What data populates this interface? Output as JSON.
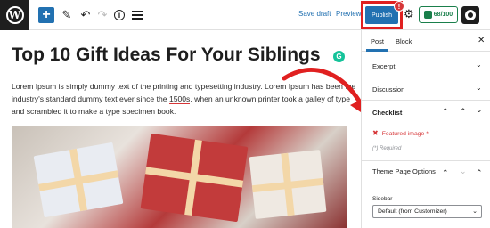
{
  "toolbar": {
    "logo": "W",
    "icons": [
      "wordpress-logo",
      "plus-icon",
      "pen-icon",
      "undo-icon",
      "redo-icon",
      "info-icon",
      "list-view-icon",
      "gear-icon",
      "settings-icon"
    ],
    "add": "+",
    "pen": "✎",
    "undo": "↶",
    "redo": "↷",
    "info": "i",
    "save_draft": "Save draft",
    "preview": "Preview",
    "publish": "Publish",
    "publish_alert": "!",
    "gear": "⚙",
    "score": "68/100",
    "accent": "#2271b1",
    "alert_color": "#d63638",
    "score_color": "#1a7f4b"
  },
  "editor": {
    "title": "Top 10 Gift Ideas For Your Siblings",
    "grammarly": "G",
    "paragraph_1": "Lorem Ipsum is simply dummy text of the printing and typesetting industry. Lorem Ipsum has been the industry's standard dummy text ever since the ",
    "paragraph_highlight": "1500s",
    "paragraph_2": ", when an unknown printer took a galley of type and scrambled it to make a type specimen book."
  },
  "sidebar": {
    "tabs": [
      "Post",
      "Block"
    ],
    "close": "✕",
    "panels": {
      "excerpt": "Excerpt",
      "discussion": "Discussion",
      "checklist": "Checklist",
      "theme_page_options": "Theme Page Options"
    },
    "chevron_down": "⌄",
    "up": "⌃",
    "down": "⌄",
    "featured_x": "✖",
    "featured_required": "Featured image *",
    "required_note": "(*) Required",
    "sidebar_label": "Sidebar",
    "sidebar_select": "Default (from Customizer)",
    "select_chevron": "⌄"
  }
}
